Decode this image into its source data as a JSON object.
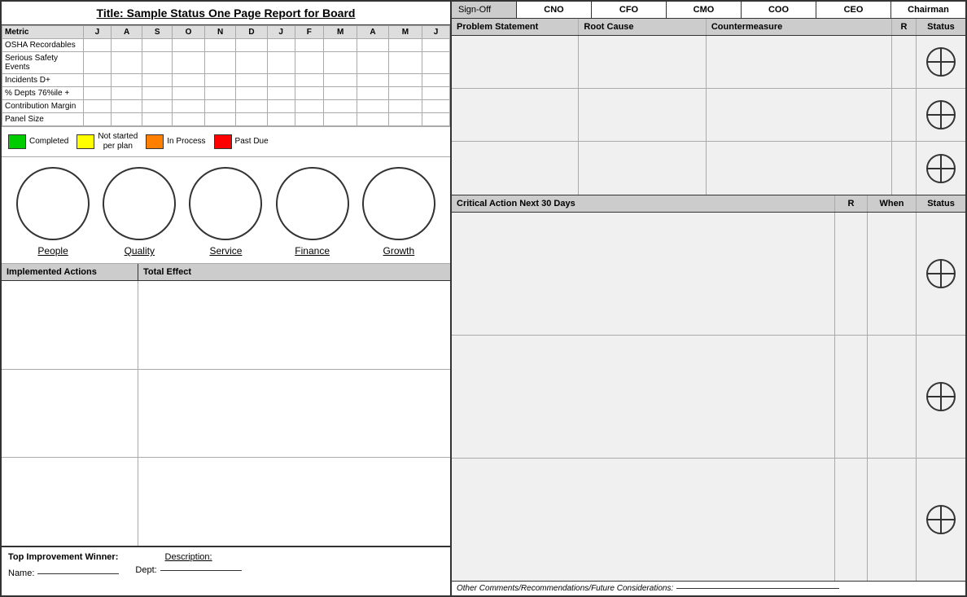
{
  "title": "Title:  Sample Status One Page Report for Board",
  "metrics": {
    "columns": [
      "Metric",
      "J",
      "A",
      "S",
      "O",
      "N",
      "D",
      "J",
      "F",
      "M",
      "A",
      "M",
      "J"
    ],
    "rows": [
      [
        "OSHA Recordables",
        "",
        "",
        "",
        "",
        "",
        "",
        "",
        "",
        "",
        "",
        "",
        ""
      ],
      [
        "Serious Safety Events",
        "",
        "",
        "",
        "",
        "",
        "",
        "",
        "",
        "",
        "",
        "",
        ""
      ],
      [
        "Incidents D+",
        "",
        "",
        "",
        "",
        "",
        "",
        "",
        "",
        "",
        "",
        "",
        ""
      ],
      [
        "% Depts 76%ile +",
        "",
        "",
        "",
        "",
        "",
        "",
        "",
        "",
        "",
        "",
        "",
        ""
      ],
      [
        "Contribution Margin",
        "",
        "",
        "",
        "",
        "",
        "",
        "",
        "",
        "",
        "",
        "",
        ""
      ],
      [
        "Panel Size",
        "",
        "",
        "",
        "",
        "",
        "",
        "",
        "",
        "",
        "",
        "",
        ""
      ]
    ]
  },
  "legend": [
    {
      "color": "#00cc00",
      "label": "Completed"
    },
    {
      "color": "#ffff00",
      "label": "Not started\nper plan"
    },
    {
      "color": "#ff8000",
      "label": "In Process"
    },
    {
      "color": "#ff0000",
      "label": "Past Due"
    }
  ],
  "circles": [
    {
      "label": "People"
    },
    {
      "label": "Quality"
    },
    {
      "label": "Service"
    },
    {
      "label": "Finance"
    },
    {
      "label": "Growth"
    }
  ],
  "implemented_actions": {
    "col1_header": "Implemented Actions",
    "col2_header": "Total Effect",
    "rows": [
      {
        "action": "",
        "effect": ""
      },
      {
        "action": "",
        "effect": ""
      },
      {
        "action": "",
        "effect": ""
      }
    ]
  },
  "winner": {
    "label": "Top Improvement Winner:",
    "name_label": "Name:",
    "dept_label": "Dept:",
    "description_label": "Description:"
  },
  "signoff": {
    "label": "Sign-Off",
    "columns": [
      "CNO",
      "CFO",
      "CMO",
      "COO",
      "CEO",
      "Chairman"
    ]
  },
  "problem_table": {
    "headers": [
      "Problem Statement",
      "Root Cause",
      "Countermeasure",
      "R",
      "Status"
    ],
    "rows": [
      {
        "problem": "",
        "root": "",
        "counter": "",
        "r": "",
        "status": "cross"
      },
      {
        "problem": "",
        "root": "",
        "counter": "",
        "r": "",
        "status": "cross"
      },
      {
        "problem": "",
        "root": "",
        "counter": "",
        "r": "",
        "status": "cross"
      }
    ]
  },
  "critical_action": {
    "headers": [
      "Critical Action Next 30 Days",
      "R",
      "When",
      "Status"
    ],
    "rows": [
      {
        "action": "",
        "r": "",
        "when": "",
        "status": "cross"
      },
      {
        "action": "",
        "r": "",
        "when": "",
        "status": "cross"
      },
      {
        "action": "",
        "r": "",
        "when": "",
        "status": "cross"
      }
    ]
  },
  "comments": {
    "label": "Other Comments/Recommendations/Future Considerations:"
  }
}
